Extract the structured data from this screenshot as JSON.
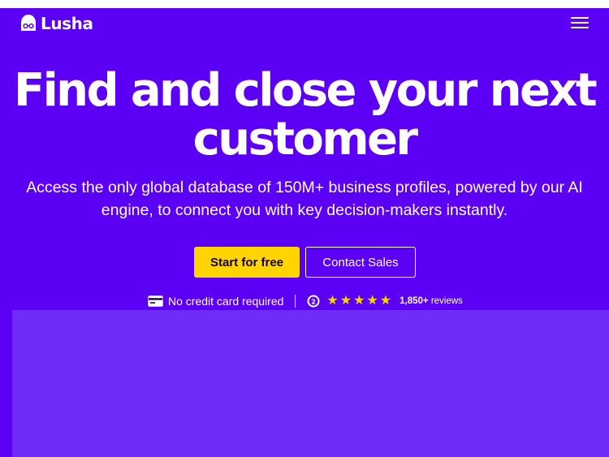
{
  "brand": {
    "name": "Lusha"
  },
  "nav": {
    "menu_icon": "hamburger-menu-icon"
  },
  "hero": {
    "headline_line1": "Find and close your next",
    "headline_line2": "customer",
    "subheadline_line1": "Access the only global database of 150M+ business profiles, powered by our AI",
    "subheadline_line2": "engine, to connect you with key decision-makers instantly.",
    "primary_cta": "Start for free",
    "secondary_cta": "Contact Sales"
  },
  "trust": {
    "no_card_text": "No credit card required",
    "card_icon": "credit-card-icon",
    "review_icon": "g2-logo-icon",
    "rating_stars": 5,
    "reviews_count": "1,850+",
    "reviews_label": "reviews"
  },
  "colors": {
    "background": "#5b00f5",
    "panel": "#6f2cf8",
    "primary_button": "#ffd400",
    "star": "#ffd400",
    "text": "#ffffff"
  }
}
